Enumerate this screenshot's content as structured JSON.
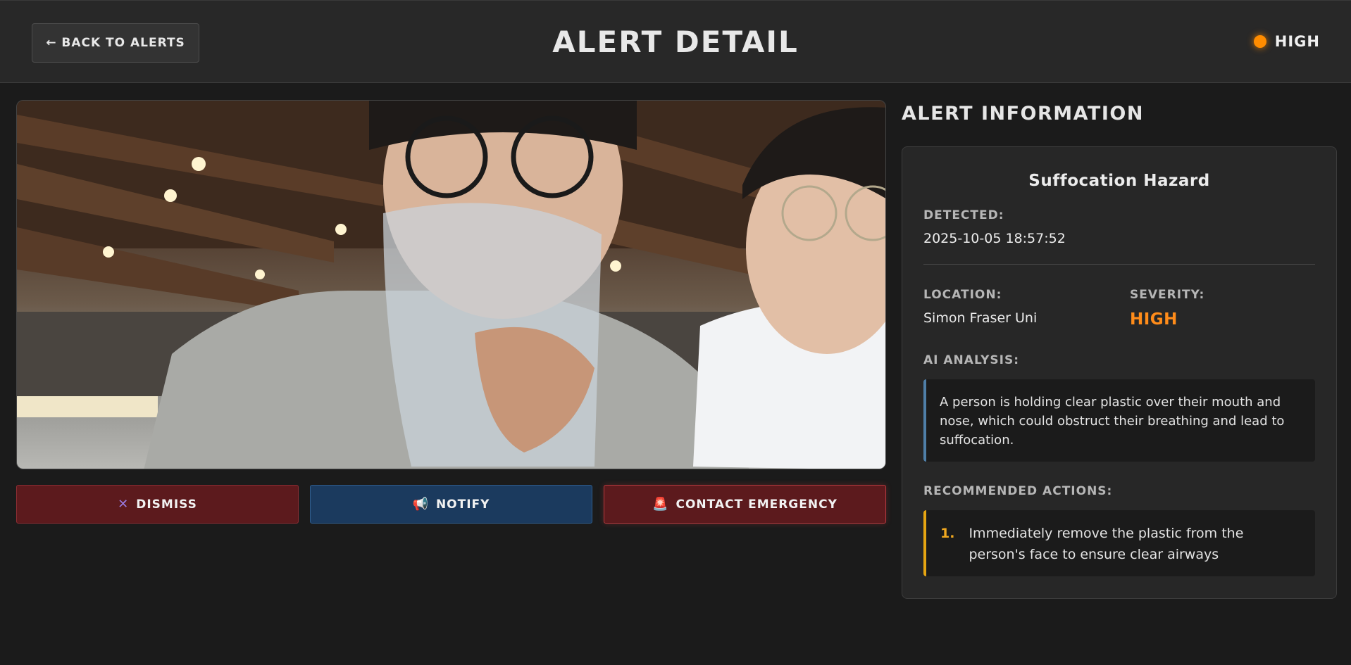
{
  "header": {
    "back_label": "← BACK TO ALERTS",
    "title": "ALERT DETAIL",
    "severity_label": "HIGH"
  },
  "image": {
    "alt": "Camera frame"
  },
  "actions": {
    "dismiss_label": "DISMISS",
    "dismiss_icon": "✕",
    "notify_label": "NOTIFY",
    "notify_icon": "📢",
    "emergency_label": "CONTACT EMERGENCY",
    "emergency_icon": "🚨"
  },
  "info": {
    "section_title": "ALERT INFORMATION",
    "hazard_title": "Suffocation Hazard",
    "detected_label": "DETECTED:",
    "detected_value": "2025-10-05 18:57:52",
    "location_label": "LOCATION:",
    "location_value": "Simon Fraser Uni",
    "severity_label": "SEVERITY:",
    "severity_value": "HIGH",
    "analysis_label": "AI ANALYSIS:",
    "analysis_text": "A person is holding clear plastic over their mouth and nose, which could obstruct their breathing and lead to suffocation.",
    "recommended_label": "RECOMMENDED ACTIONS:",
    "recommended": [
      {
        "num": "1.",
        "text": "Immediately remove the plastic from the person's face to ensure clear airways"
      }
    ]
  },
  "colors": {
    "background": "#1b1b1b",
    "severity_high": "#ff8c1a",
    "dismiss_bg": "#5c1a1d",
    "notify_bg": "#1b3a5e",
    "analysis_accent": "#4f7fa8",
    "recommend_accent": "#e6a512"
  }
}
